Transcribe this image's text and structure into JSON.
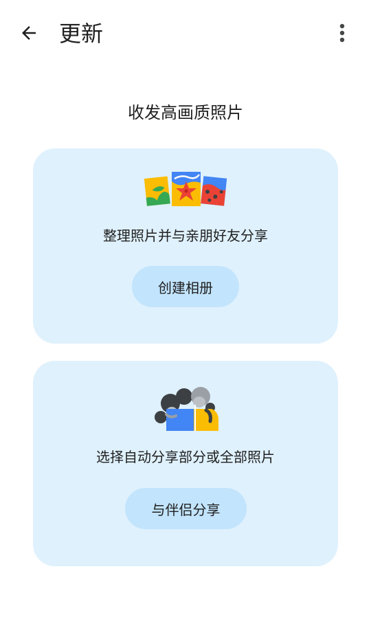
{
  "header": {
    "title": "更新",
    "back_icon": "arrow-back-icon",
    "more_icon": "more-vert-icon"
  },
  "main": {
    "section_title": "收发高画质照片",
    "cards": [
      {
        "illustration": "photo-collage-illustration",
        "text": "整理照片并与亲朋好友分享",
        "button_label": "创建相册"
      },
      {
        "illustration": "partners-illustration",
        "text": "选择自动分享部分或全部照片",
        "button_label": "与伴侣分享"
      }
    ]
  },
  "colors": {
    "card_background": "#dff1fd",
    "button_background": "#c2e4fc",
    "text": "#1f1f1f"
  }
}
